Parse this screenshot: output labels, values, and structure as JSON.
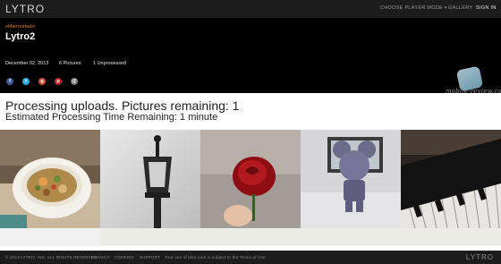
{
  "header": {
    "logo": "LYTRO",
    "nav": {
      "player_mode": "CHOOSE PLAYER MODE",
      "gallery": "GALLERY",
      "sign_in": "SIGN IN"
    }
  },
  "album": {
    "username": "eldarmurtazin",
    "title": "Lytro2",
    "date": "December 02, 2013",
    "pictures": "6 Pictures",
    "unprocessed": "1 Unprocessed"
  },
  "share_icons": [
    "facebook-icon",
    "twitter-icon",
    "google-plus-icon",
    "pinterest-icon",
    "email-icon"
  ],
  "share_colors": [
    "#3b5998",
    "#2aa9e0",
    "#d34836",
    "#c8232c",
    "#777777"
  ],
  "watermark": "mobile-review.com",
  "status": {
    "processing": "Processing uploads. Pictures remaining: 1",
    "estimate": "Estimated Processing Time Remaining: 1 minute"
  },
  "photos": [
    "salad-bowl",
    "street-lamp",
    "red-rose",
    "mickey-figurine",
    "piano-keys"
  ],
  "footer": {
    "copyright": "© 2013 LYTRO, INC. ALL RIGHTS RESERVED",
    "privacy": "PRIVACY",
    "cookies": "COOKIES",
    "support": "SUPPORT",
    "terms": "Your use of lytro.com is subject to the Terms of Use",
    "logo": "LYTRO"
  }
}
